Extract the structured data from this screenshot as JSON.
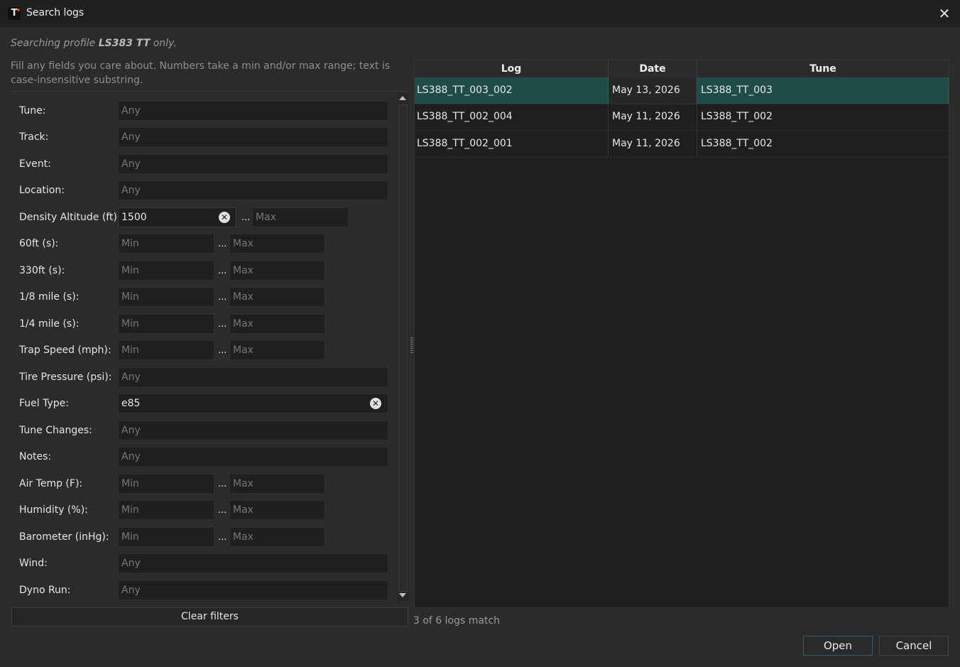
{
  "window": {
    "title": "Search logs",
    "icon": "app-logo-icon",
    "close_icon": "close-icon"
  },
  "profile_note": {
    "prefix": "Searching profile ",
    "profile": "LS383 TT",
    "suffix": " only."
  },
  "help_text": "Fill any fields you care about. Numbers take a min and/or max range; text is case-insensitive substring.",
  "form": {
    "tune": {
      "label": "Tune:",
      "placeholder": "Any"
    },
    "track": {
      "label": "Track:",
      "placeholder": "Any"
    },
    "event": {
      "label": "Event:",
      "placeholder": "Any"
    },
    "location": {
      "label": "Location:",
      "placeholder": "Any"
    },
    "density_altitude": {
      "label": "Density Altitude (ft):",
      "min_value": "1500",
      "sep": "...",
      "max_placeholder": "Max"
    },
    "sixty_ft": {
      "label": "60ft (s):",
      "min_placeholder": "Min",
      "sep": "...",
      "max_placeholder": "Max"
    },
    "three30_ft": {
      "label": "330ft (s):",
      "min_placeholder": "Min",
      "sep": "...",
      "max_placeholder": "Max"
    },
    "eighth_mile": {
      "label": "1/8 mile (s):",
      "min_placeholder": "Min",
      "sep": "...",
      "max_placeholder": "Max"
    },
    "quarter_mile": {
      "label": "1/4 mile (s):",
      "min_placeholder": "Min",
      "sep": "...",
      "max_placeholder": "Max"
    },
    "trap_speed": {
      "label": "Trap Speed (mph):",
      "min_placeholder": "Min",
      "sep": "...",
      "max_placeholder": "Max"
    },
    "tire_pressure": {
      "label": "Tire Pressure (psi):",
      "placeholder": "Any"
    },
    "fuel_type": {
      "label": "Fuel Type:",
      "value": "e85"
    },
    "tune_changes": {
      "label": "Tune Changes:",
      "placeholder": "Any"
    },
    "notes": {
      "label": "Notes:",
      "placeholder": "Any"
    },
    "air_temp": {
      "label": "Air Temp (F):",
      "min_placeholder": "Min",
      "sep": "...",
      "max_placeholder": "Max"
    },
    "humidity": {
      "label": "Humidity (%):",
      "min_placeholder": "Min",
      "sep": "...",
      "max_placeholder": "Max"
    },
    "barometer": {
      "label": "Barometer (inHg):",
      "min_placeholder": "Min",
      "sep": "...",
      "max_placeholder": "Max"
    },
    "wind": {
      "label": "Wind:",
      "placeholder": "Any"
    },
    "dyno_run": {
      "label": "Dyno Run:",
      "placeholder": "Any"
    },
    "clear_glyph": "✕"
  },
  "clear_filters_label": "Clear filters",
  "results": {
    "columns": [
      "Log",
      "Date",
      "Tune"
    ],
    "rows": [
      {
        "log": "LS388_TT_003_002",
        "date": "May 13, 2026",
        "tune": "LS388_TT_003",
        "selected": true
      },
      {
        "log": "LS388_TT_002_004",
        "date": "May 11, 2026",
        "tune": "LS388_TT_002",
        "selected": false
      },
      {
        "log": "LS388_TT_002_001",
        "date": "May 11, 2026",
        "tune": "LS388_TT_002",
        "selected": false
      }
    ],
    "selected_color": "#1f4b48"
  },
  "match_count": "3 of 6 logs match",
  "buttons": {
    "open": "Open",
    "cancel": "Cancel"
  },
  "colors": {
    "background": "#2b2b2b",
    "titlebar": "#202020",
    "input_bg": "#1f1f1f",
    "selection": "#1f4b48"
  }
}
